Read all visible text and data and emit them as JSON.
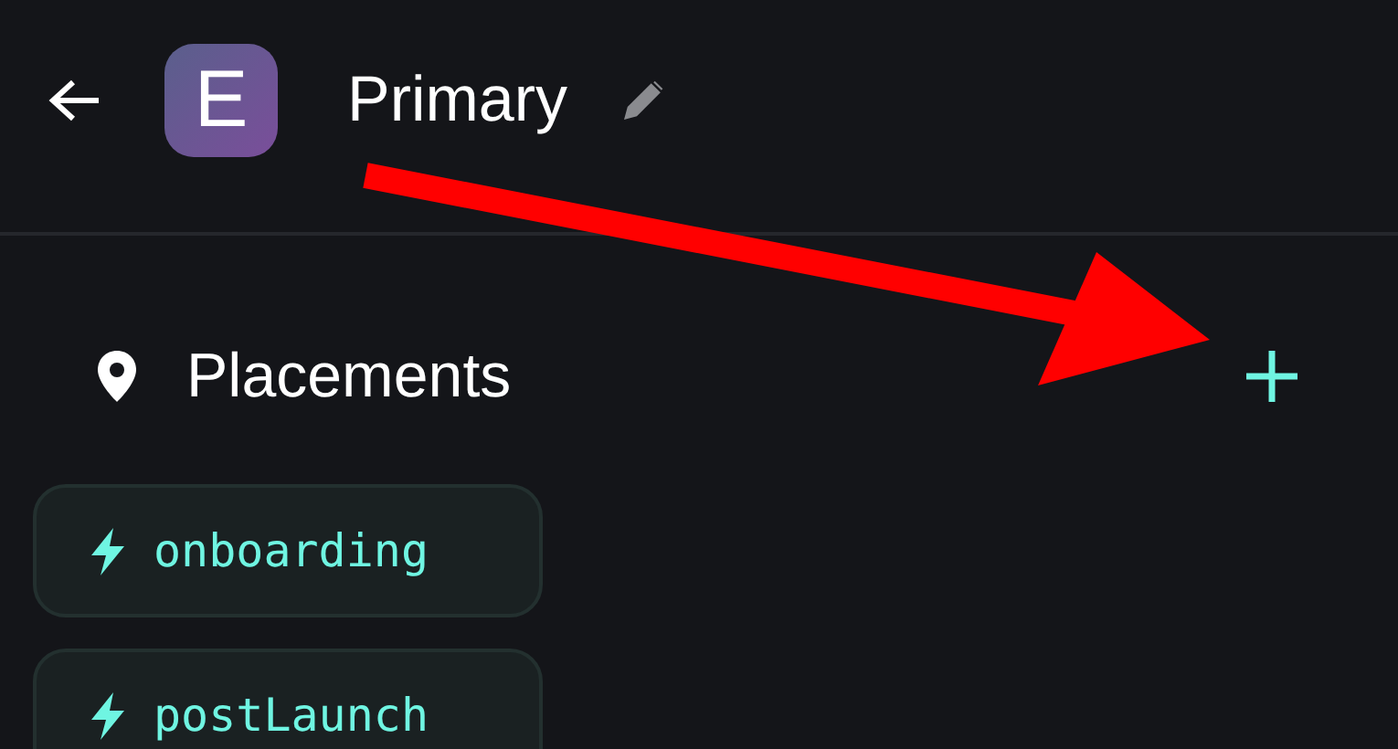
{
  "header": {
    "app_icon_letter": "E",
    "title": "Primary"
  },
  "section": {
    "title": "Placements"
  },
  "placements": [
    {
      "name": "onboarding"
    },
    {
      "name": "postLaunch"
    }
  ]
}
